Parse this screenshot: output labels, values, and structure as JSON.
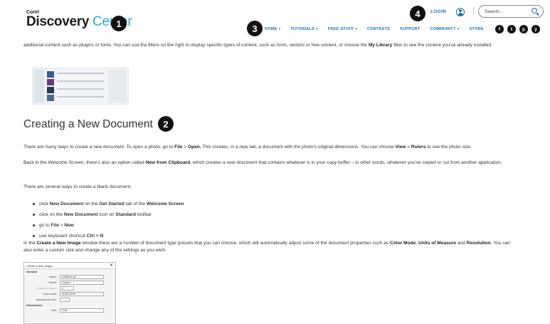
{
  "logo": {
    "brand_small": "Corel",
    "brand_main": "Discovery",
    "brand_accent": "Center"
  },
  "badges": {
    "one": "1",
    "two": "2",
    "three": "3",
    "four": "4"
  },
  "header": {
    "login": "LOGIN",
    "search_placeholder": "Search...",
    "nav": [
      "HOME",
      "TUTORIALS",
      "FREE STUFF",
      "CONTESTS",
      "SUPPORT",
      "COMMUNITY",
      "STORE"
    ],
    "socials": [
      "f",
      "t",
      "p",
      "y"
    ]
  },
  "content": {
    "intro_a": "additional content such as plugins or fonts. You can use the filters on the right to display specific types of content, such as fonts, vectors or free content, or choose the ",
    "intro_b": "My Library",
    "intro_c": " filter to see the content you've already installed.",
    "heading": "Creating a New Document",
    "p1_a": "There are many ways to create a new document. To open a photo, go to ",
    "p1_b": "File",
    "p1_c": " > ",
    "p1_d": "Open.",
    "p1_e": " This creates, in a new tab, a document with the photo's original dimensions. You can choose ",
    "p1_f": "View",
    "p1_g": " > ",
    "p1_h": "Rulers",
    "p1_i": " to see the photo size.",
    "p2_a": "Back in the Welcome Screen, there's also an option called ",
    "p2_b": "New from Clipboard",
    "p2_c": ", which creates a new document that contains whatever is in your copy buffer – in other words, whatever you've copied or cut from another application.",
    "p3": "There are several ways to create a blank document:",
    "bullets": [
      {
        "a": "click ",
        "b": "New Document",
        "c": " on the ",
        "d": "Get Started",
        "e": " tab of the ",
        "f": "Welcome Screen"
      },
      {
        "a": "click on the ",
        "b": "New Document",
        "c": " icon on ",
        "d": "Standard",
        "e": " toolbar"
      },
      {
        "a": "go to ",
        "b": "File",
        "c": " > ",
        "d": "New"
      },
      {
        "a": "use keyboard shortcut ",
        "b": "Ctrl + N"
      }
    ],
    "p4_a": "In the ",
    "p4_b": "Create a New Image",
    "p4_c": " window there are a number of document type presets that you can choose, which will automatically adjust some of the document properties such as ",
    "p4_d": "Color Mode",
    "p4_e": ", ",
    "p4_f": "Units of Measure",
    "p4_g": " and ",
    "p4_h": "Resolution",
    "p4_i": ". You can also enter a custom size and change any of the settings as you wish."
  },
  "dialog": {
    "title": "Create a New Image",
    "general": "General",
    "name_label": "Name:",
    "name_value": "Untitled-4.cpt",
    "preset_label": "Preset:",
    "preset_value": "Custom",
    "docs_label": "Number of pages:",
    "docs_value": "1",
    "color_label": "Color mode:",
    "color_value": "32-Bit CMYK",
    "bg_label": "Background color:",
    "dimensions": "Dimensions",
    "size_label": "Size:",
    "size_value": "4\"x6\""
  }
}
